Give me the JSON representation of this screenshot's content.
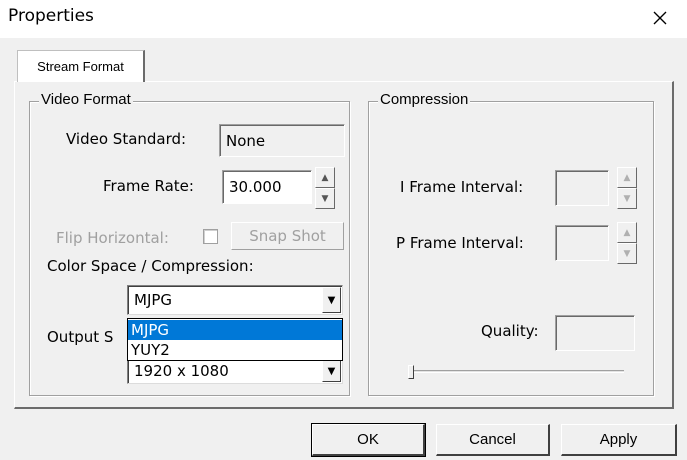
{
  "window": {
    "title": "Properties",
    "close_icon": "close-icon"
  },
  "tabs": [
    {
      "label": "Stream Format",
      "active": true
    }
  ],
  "video_format": {
    "group_label": "Video Format",
    "video_standard_label": "Video Standard:",
    "video_standard_value": "None",
    "frame_rate_label": "Frame Rate:",
    "frame_rate_value": "30.000",
    "flip_horizontal_label": "Flip Horizontal:",
    "flip_horizontal_checked": false,
    "snap_shot_label": "Snap Shot",
    "color_space_label": "Color Space / Compression:",
    "color_space_value": "MJPG",
    "color_space_options": [
      "MJPG",
      "YUY2"
    ],
    "color_space_highlighted": "MJPG",
    "output_size_label": "Output S",
    "output_size_value": "1920 x 1080"
  },
  "compression": {
    "group_label": "Compression",
    "i_frame_label": "I Frame Interval:",
    "i_frame_value": "",
    "p_frame_label": "P Frame Interval:",
    "p_frame_value": "",
    "quality_label": "Quality:",
    "quality_value": "",
    "quality_slider_position": 0
  },
  "buttons": {
    "ok": "OK",
    "cancel": "Cancel",
    "apply": "Apply"
  },
  "colors": {
    "selection": "#0078d7",
    "face": "#f0f0f0"
  }
}
